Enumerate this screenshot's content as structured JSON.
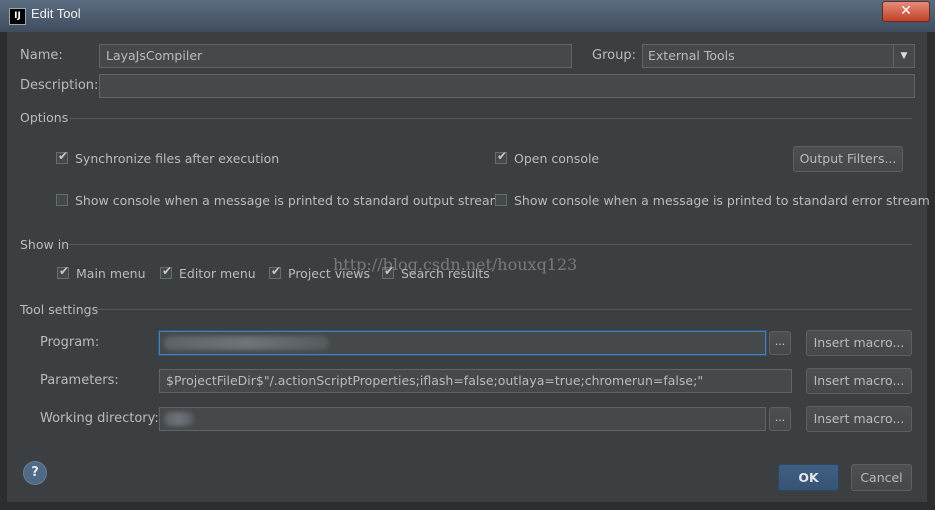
{
  "window": {
    "title": "Edit Tool",
    "close_icon": "✕"
  },
  "name": {
    "label": "Name:",
    "value": "LayaJsCompiler"
  },
  "group": {
    "label": "Group:",
    "value": "External Tools"
  },
  "description": {
    "label": "Description:",
    "value": ""
  },
  "options": {
    "label": "Options",
    "sync_files": {
      "label": "Synchronize files after execution",
      "checked": true
    },
    "open_console": {
      "label": "Open console",
      "checked": true
    },
    "output_filters": "Output Filters...",
    "show_console_stdout": {
      "label": "Show console when a message is printed to standard output stream",
      "checked": false
    },
    "show_console_stderr": {
      "label": "Show console when a message is printed to standard error stream",
      "checked": false
    }
  },
  "show_in": {
    "label": "Show in",
    "items": [
      {
        "label": "Main menu",
        "checked": true
      },
      {
        "label": "Editor menu",
        "checked": true
      },
      {
        "label": "Project views",
        "checked": true
      },
      {
        "label": "Search results",
        "checked": true
      }
    ]
  },
  "tool_settings": {
    "label": "Tool settings",
    "program": {
      "label": "Program:",
      "value": ""
    },
    "parameters": {
      "label": "Parameters:",
      "value": "$ProjectFileDir$\"/.actionScriptProperties;iflash=false;outlaya=true;chromerun=false;\""
    },
    "working_directory": {
      "label": "Working directory:",
      "value": ""
    },
    "browse_label": "...",
    "insert_macro": "Insert macro..."
  },
  "footer": {
    "help": "?",
    "ok": "OK",
    "cancel": "Cancel"
  },
  "watermark": "http://blog.csdn.net/houxq123"
}
